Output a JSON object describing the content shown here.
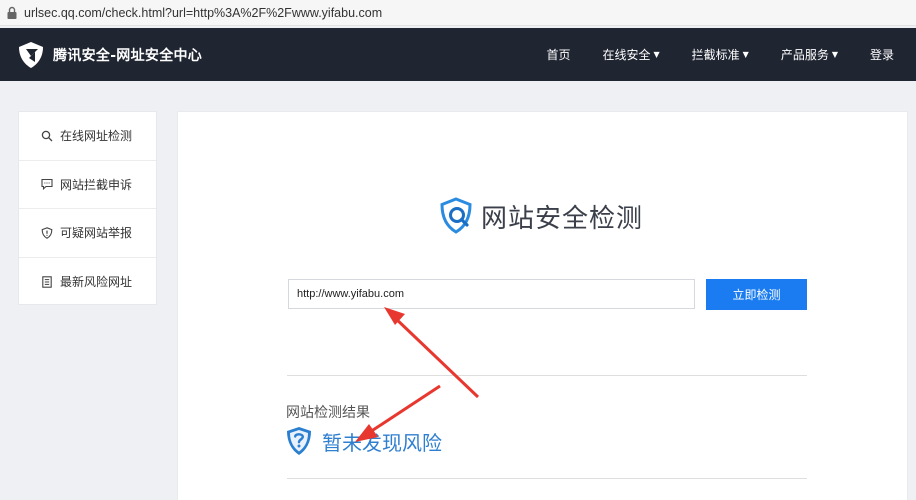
{
  "browser": {
    "url": "urlsec.qq.com/check.html?url=http%3A%2F%2Fwww.yifabu.com"
  },
  "header": {
    "title": "腾讯安全-网址安全中心",
    "nav": [
      {
        "label": "首页"
      },
      {
        "label": "在线安全"
      },
      {
        "label": "拦截标准"
      },
      {
        "label": "产品服务"
      },
      {
        "label": "登录"
      }
    ]
  },
  "sidebar": {
    "items": [
      {
        "label": "在线网址检测",
        "icon": "search-icon"
      },
      {
        "label": "网站拦截申诉",
        "icon": "message-icon"
      },
      {
        "label": "可疑网站举报",
        "icon": "shield-icon"
      },
      {
        "label": "最新风险网址",
        "icon": "list-icon"
      }
    ]
  },
  "main": {
    "heading": "网站安全检测",
    "search": {
      "value": "http://www.yifabu.com",
      "button_label": "立即检测"
    },
    "result": {
      "label": "网站检测结果",
      "status": "暂未发现风险",
      "status_color": "#2f7fd0"
    }
  },
  "colors": {
    "nav_bg": "#1f2531",
    "accent": "#1a7cf0",
    "arrow": "#e8372e"
  }
}
